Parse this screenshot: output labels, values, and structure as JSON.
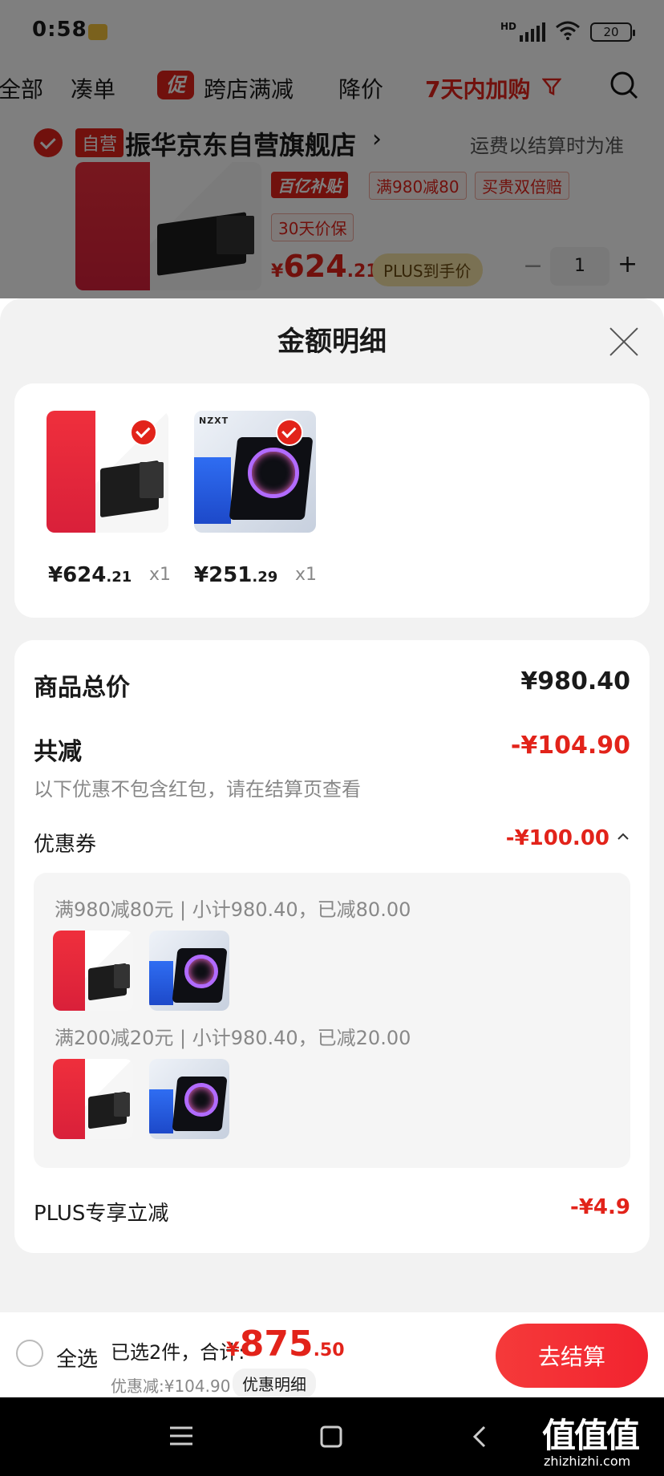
{
  "status_bar": {
    "time": "0:58",
    "hd": "HD",
    "battery": "20"
  },
  "filter_bar": {
    "items": [
      "全部",
      "凑单",
      "跨店满减",
      "降价",
      "7天内加购"
    ],
    "promo_badge": "促"
  },
  "store": {
    "self_badge": "自营",
    "name": "振华京东自营旗舰店",
    "chevron": "›",
    "shipping": "运费以结算时为准",
    "tags": [
      "百亿补贴",
      "满980减80",
      "买贵双倍赔",
      "30天价保"
    ],
    "price_symbol": "¥",
    "price_int": "624",
    "price_dec": ".21",
    "plus_label": "PLUS到手价",
    "qty": "1",
    "minus": "−",
    "plus": "+"
  },
  "sheet": {
    "title": "金额明细",
    "products": [
      {
        "price_int": "¥624",
        "price_dec": ".21",
        "qty": "x1",
        "brand": ""
      },
      {
        "price_int": "¥251",
        "price_dec": ".29",
        "qty": "x1",
        "brand": "NZXT"
      }
    ],
    "total_label": "商品总价",
    "total_value": "¥980.40",
    "discount_label": "共减",
    "discount_value": "-¥104.90",
    "discount_note": "以下优惠不包含红包，请在结算页查看",
    "coupon_label": "优惠券",
    "coupon_value": "-¥100.00",
    "coupon_rules": [
      "满980减80元 | 小计980.40，已减80.00",
      "满200减20元 | 小计980.40，已减20.00"
    ],
    "plus_label": "PLUS专享立减",
    "plus_value": "-¥4.9"
  },
  "bottom_bar": {
    "select_all": "全选",
    "selected_text": "已选2件，合计:",
    "total_symbol": "¥",
    "total_int": "875",
    "total_dec": ".50",
    "discount_text": "优惠减:¥104.90",
    "detail_button": "优惠明细",
    "checkout_button": "去结算"
  },
  "watermark": {
    "text": "值值值",
    "site": "zhizhizhi.com"
  },
  "colors": {
    "accent": "#e2231a",
    "overlay": "rgba(0,0,0,0.5)",
    "sheet_bg": "#f2f2f2"
  }
}
